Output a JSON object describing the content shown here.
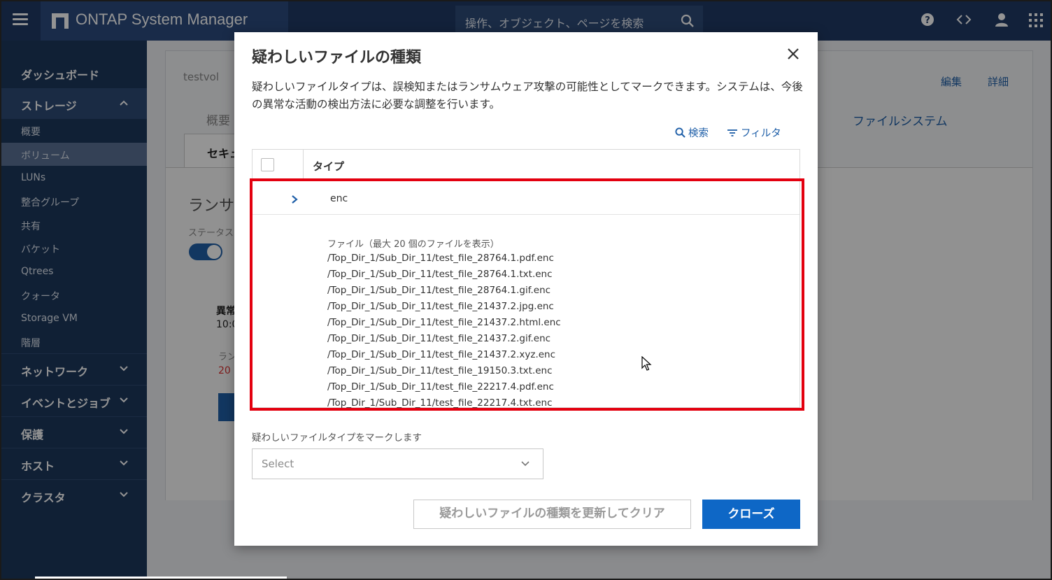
{
  "app": {
    "title": "ONTAP System Manager"
  },
  "search": {
    "placeholder": "操作、オブジェクト、ページを検索"
  },
  "sidebar": {
    "dashboard": "ダッシュボード",
    "storage": "ストレージ",
    "storage_items": [
      "概要",
      "ボリューム",
      "LUNs",
      "整合グループ",
      "共有",
      "バケット",
      "Qtrees",
      "クォータ",
      "Storage VM",
      "階層"
    ],
    "network": "ネットワーク",
    "events": "イベントとジョブ",
    "protection": "保護",
    "hosts": "ホスト",
    "cluster": "クラスタ"
  },
  "page": {
    "volume_name": "testvol",
    "tab_overview": "概要",
    "tab_security_partial": "セキュ",
    "tab_filesystem": "ファイルシステム",
    "edit": "編集",
    "details": "詳細",
    "ransomware_partial": "ランサ",
    "status_partial": "ステータス",
    "warn_partial": "異常",
    "time_partial": "10:0",
    "ran_partial": "ラン",
    "count_partial": "20 "
  },
  "modal": {
    "title": "疑わしいファイルの種類",
    "description": "疑わしいファイルタイプは、誤検知またはランサムウェア攻撃の可能性としてマークできます。システムは、今後の異常な活動の検出方法に必要な調整を行います。",
    "search_label": "検索",
    "filter_label": "フィルタ",
    "column_type": "タイプ",
    "row_type": "enc",
    "files_header": "ファイル（最大 20 個のファイルを表示）",
    "files": [
      "/Top_Dir_1/Sub_Dir_11/test_file_28764.1.pdf.enc",
      "/Top_Dir_1/Sub_Dir_11/test_file_28764.1.txt.enc",
      "/Top_Dir_1/Sub_Dir_11/test_file_28764.1.gif.enc",
      "/Top_Dir_1/Sub_Dir_11/test_file_21437.2.jpg.enc",
      "/Top_Dir_1/Sub_Dir_11/test_file_21437.2.html.enc",
      "/Top_Dir_1/Sub_Dir_11/test_file_21437.2.gif.enc",
      "/Top_Dir_1/Sub_Dir_11/test_file_21437.2.xyz.enc",
      "/Top_Dir_1/Sub_Dir_11/test_file_19150.3.txt.enc",
      "/Top_Dir_1/Sub_Dir_11/test_file_22217.4.pdf.enc",
      "/Top_Dir_1/Sub_Dir_11/test_file_22217.4.txt.enc"
    ],
    "mark_label": "疑わしいファイルタイプをマークします",
    "select_placeholder": "Select",
    "update_button": "疑わしいファイルの種類を更新してクリア",
    "close_button": "クローズ"
  },
  "colors": {
    "topbar": "#1f3a64",
    "sidebar": "#1d375c",
    "primary": "#0e67c6",
    "highlight": "#e3000f"
  }
}
